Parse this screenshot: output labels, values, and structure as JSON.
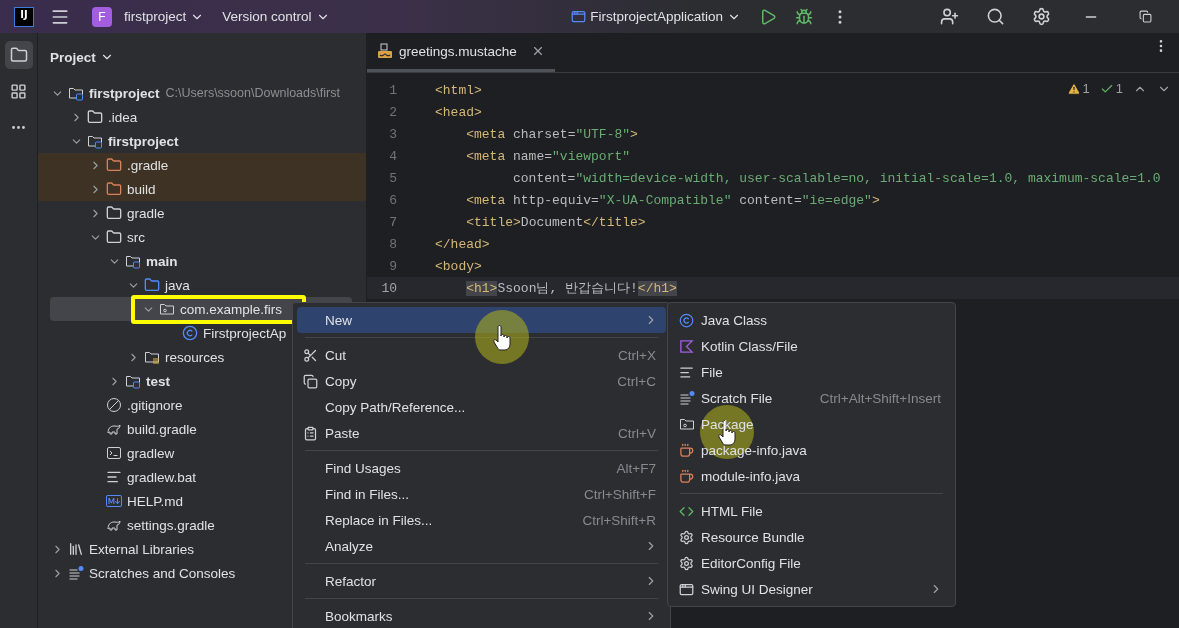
{
  "title_bar": {
    "logo": "IJ",
    "project_badge": "F",
    "project": "firstproject",
    "vcs": "Version control",
    "run_config": "FirstprojectApplication"
  },
  "tool_strip": [
    {
      "kind": "project",
      "selected": true
    },
    {
      "kind": "structure",
      "selected": false
    },
    {
      "kind": "more",
      "selected": false
    }
  ],
  "project_panel": {
    "title": "Project",
    "tree": [
      {
        "label": "firstproject",
        "kind": "module",
        "bold": true,
        "note": "C:\\Users\\ssoon\\Downloads\\first",
        "expanded": true,
        "selected": false,
        "outlined": false,
        "children": [
          {
            "label": ".idea",
            "kind": "folder",
            "expanded": false,
            "selected": false,
            "outlined": false
          },
          {
            "label": "firstproject",
            "kind": "module",
            "bold": true,
            "expanded": true,
            "selected": false,
            "outlined": false,
            "children": [
              {
                "label": ".gradle",
                "kind": "excluded",
                "expanded": false,
                "selected": false,
                "outlined": false
              },
              {
                "label": "build",
                "kind": "excluded",
                "expanded": false,
                "selected": false,
                "outlined": false
              },
              {
                "label": "gradle",
                "kind": "folder",
                "expanded": false,
                "selected": false,
                "outlined": false
              },
              {
                "label": "src",
                "kind": "folder",
                "expanded": true,
                "selected": false,
                "outlined": false,
                "children": [
                  {
                    "label": "main",
                    "kind": "module",
                    "bold": true,
                    "expanded": true,
                    "selected": false,
                    "outlined": false,
                    "children": [
                      {
                        "label": "java",
                        "kind": "source",
                        "expanded": true,
                        "selected": false,
                        "outlined": false,
                        "children": [
                          {
                            "label": "com.example.firs",
                            "kind": "package",
                            "expanded": true,
                            "selected": true,
                            "outlined": true,
                            "children": [
                              {
                                "label": "FirstprojectAp",
                                "kind": "class",
                                "selected": false,
                                "outlined": false
                              }
                            ]
                          }
                        ]
                      },
                      {
                        "label": "resources",
                        "kind": "resources",
                        "expanded": false,
                        "selected": false,
                        "outlined": false
                      }
                    ]
                  },
                  {
                    "label": "test",
                    "kind": "module",
                    "bold": true,
                    "expanded": false,
                    "selected": false,
                    "outlined": false
                  }
                ]
              },
              {
                "label": ".gitignore",
                "kind": "ignore",
                "selected": false,
                "outlined": false
              },
              {
                "label": "build.gradle",
                "kind": "gradle",
                "selected": false,
                "outlined": false
              },
              {
                "label": "gradlew",
                "kind": "script",
                "selected": false,
                "outlined": false
              },
              {
                "label": "gradlew.bat",
                "kind": "text",
                "selected": false,
                "outlined": false
              },
              {
                "label": "HELP.md",
                "kind": "markdown",
                "selected": false,
                "outlined": false
              },
              {
                "label": "settings.gradle",
                "kind": "gradle",
                "selected": false,
                "outlined": false
              }
            ]
          }
        ]
      },
      {
        "label": "External Libraries",
        "kind": "library",
        "expanded": false,
        "selected": false,
        "outlined": false
      },
      {
        "label": "Scratches and Consoles",
        "kind": "scratches",
        "expanded": false,
        "selected": false,
        "outlined": false
      }
    ]
  },
  "editor": {
    "tabs": [
      {
        "label": "greetings.mustache",
        "selected": true
      }
    ],
    "inspections": {
      "warnings": "1",
      "ok": "1"
    },
    "lines": [
      {
        "number": "1",
        "current": false,
        "segments": [
          {
            "kind": "tag",
            "text": "<html>"
          }
        ]
      },
      {
        "number": "2",
        "current": false,
        "segments": [
          {
            "kind": "tag",
            "text": "<head>"
          }
        ]
      },
      {
        "number": "3",
        "current": false,
        "segments": [
          {
            "kind": "tag",
            "text": "    <meta"
          },
          {
            "kind": "attr",
            "text": " charset="
          },
          {
            "kind": "string",
            "text": "\"UTF-8\""
          },
          {
            "kind": "tag",
            "text": ">"
          }
        ]
      },
      {
        "number": "4",
        "current": false,
        "segments": [
          {
            "kind": "tag",
            "text": "    <meta"
          },
          {
            "kind": "attr",
            "text": " name="
          },
          {
            "kind": "string",
            "text": "\"viewport\""
          }
        ]
      },
      {
        "number": "5",
        "current": false,
        "segments": [
          {
            "kind": "attr",
            "text": "          content="
          },
          {
            "kind": "string",
            "text": "\"width=device-width, user-scalable=no, initial-scale=1.0, maximum-scale=1.0"
          }
        ]
      },
      {
        "number": "6",
        "current": false,
        "segments": [
          {
            "kind": "tag",
            "text": "    <meta"
          },
          {
            "kind": "attr",
            "text": " http-equiv="
          },
          {
            "kind": "string",
            "text": "\"X-UA-Compatible\""
          },
          {
            "kind": "attr",
            "text": " content="
          },
          {
            "kind": "string",
            "text": "\"ie=edge\""
          },
          {
            "kind": "tag",
            "text": ">"
          }
        ]
      },
      {
        "number": "7",
        "current": false,
        "segments": [
          {
            "kind": "tag",
            "text": "    <title>"
          },
          {
            "kind": "text",
            "text": "Document"
          },
          {
            "kind": "tag",
            "text": "</title>"
          }
        ]
      },
      {
        "number": "8",
        "current": false,
        "segments": [
          {
            "kind": "tag",
            "text": "</head>"
          }
        ]
      },
      {
        "number": "9",
        "current": false,
        "segments": [
          {
            "kind": "tag",
            "text": "<body>"
          }
        ]
      },
      {
        "number": "10",
        "current": true,
        "segments": [
          {
            "kind": "matched",
            "text": "    <h1>"
          },
          {
            "kind": "text",
            "text": "Ssoon님, 반갑습니다!"
          },
          {
            "kind": "matched",
            "text": "</h1>"
          }
        ]
      }
    ]
  },
  "context_menu": {
    "groups": [
      [
        {
          "label": "New",
          "selected": true,
          "submenu": true,
          "pointer": true
        }
      ],
      [
        {
          "label": "Cut",
          "kind": "scissors",
          "shortcut": "Ctrl+X",
          "selected": false,
          "pointer": false
        },
        {
          "label": "Copy",
          "kind": "copy",
          "shortcut": "Ctrl+C",
          "selected": false,
          "pointer": false
        },
        {
          "label": "Copy Path/Reference...",
          "selected": false,
          "pointer": false
        },
        {
          "label": "Paste",
          "kind": "paste",
          "shortcut": "Ctrl+V",
          "selected": false,
          "pointer": false
        }
      ],
      [
        {
          "label": "Find Usages",
          "shortcut": "Alt+F7",
          "selected": false,
          "pointer": false
        },
        {
          "label": "Find in Files...",
          "shortcut": "Ctrl+Shift+F",
          "selected": false,
          "pointer": false
        },
        {
          "label": "Replace in Files...",
          "shortcut": "Ctrl+Shift+R",
          "selected": false,
          "pointer": false
        },
        {
          "label": "Analyze",
          "submenu": true,
          "selected": false,
          "pointer": false
        }
      ],
      [
        {
          "label": "Refactor",
          "submenu": true,
          "selected": false,
          "pointer": false
        }
      ],
      [
        {
          "label": "Bookmarks",
          "submenu": true,
          "selected": false,
          "pointer": false
        }
      ]
    ]
  },
  "new_submenu": {
    "groups": [
      [
        {
          "label": "Java Class",
          "kind": "class",
          "selected": false,
          "pointer": false
        },
        {
          "label": "Kotlin Class/File",
          "kind": "kotlin",
          "selected": false,
          "pointer": false
        },
        {
          "label": "File",
          "kind": "text",
          "selected": false,
          "pointer": false
        },
        {
          "label": "Scratch File",
          "kind": "scratch",
          "shortcut": "Ctrl+Alt+Shift+Insert",
          "selected": false,
          "pointer": false
        },
        {
          "label": "Package",
          "kind": "package",
          "selected": false,
          "pointer": true
        },
        {
          "label": "package-info.java",
          "kind": "cup",
          "selected": false,
          "pointer": false
        },
        {
          "label": "module-info.java",
          "kind": "cup",
          "selected": false,
          "pointer": false
        }
      ],
      [
        {
          "label": "HTML File",
          "kind": "html",
          "selected": false,
          "pointer": false
        },
        {
          "label": "Resource Bundle",
          "kind": "gear",
          "selected": false,
          "pointer": false
        },
        {
          "label": "EditorConfig File",
          "kind": "gear",
          "selected": false,
          "pointer": false
        },
        {
          "label": "Swing UI Designer",
          "kind": "window",
          "submenu": true,
          "selected": false,
          "pointer": false
        }
      ]
    ]
  }
}
